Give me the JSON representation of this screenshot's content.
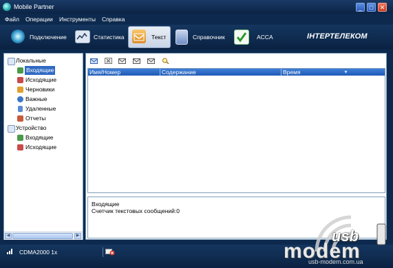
{
  "window": {
    "title": "Mobile Partner"
  },
  "menu": [
    "Файл",
    "Операции",
    "Инструменты",
    "Справка"
  ],
  "toolbar": {
    "items": [
      {
        "label": "Подключение",
        "icon": "connect-icon"
      },
      {
        "label": "Статистика",
        "icon": "statistics-icon"
      },
      {
        "label": "Текст",
        "icon": "text-message-icon",
        "active": true
      },
      {
        "label": "Справочник",
        "icon": "phonebook-icon"
      },
      {
        "label": "ACCA",
        "icon": "check-icon"
      }
    ],
    "brand": "ІНТЕРТЕЛЕКОМ"
  },
  "tree": {
    "groups": [
      {
        "label": "Локальные",
        "items": [
          "Входящие",
          "Исходящие",
          "Черновики",
          "Важные",
          "Удаленные",
          "Отчеты"
        ]
      },
      {
        "label": "Устройство",
        "items": [
          "Входящие",
          "Исходящие"
        ]
      }
    ],
    "selected": "Входящие"
  },
  "message_list": {
    "columns": [
      "Имя/Номер",
      "Содержание",
      "Время"
    ]
  },
  "preview": {
    "folder": "Входящие",
    "counter": "Счетчик текстовых сообщений:0"
  },
  "status": {
    "network": "CDMA2000 1x"
  },
  "watermark": {
    "word1": "usb",
    "word2": "modem",
    "url": "usb-modem.com.ua"
  },
  "colors": {
    "chrome": "#0d2a4e",
    "selection": "#316ac5",
    "header": "#2f6fd0"
  }
}
